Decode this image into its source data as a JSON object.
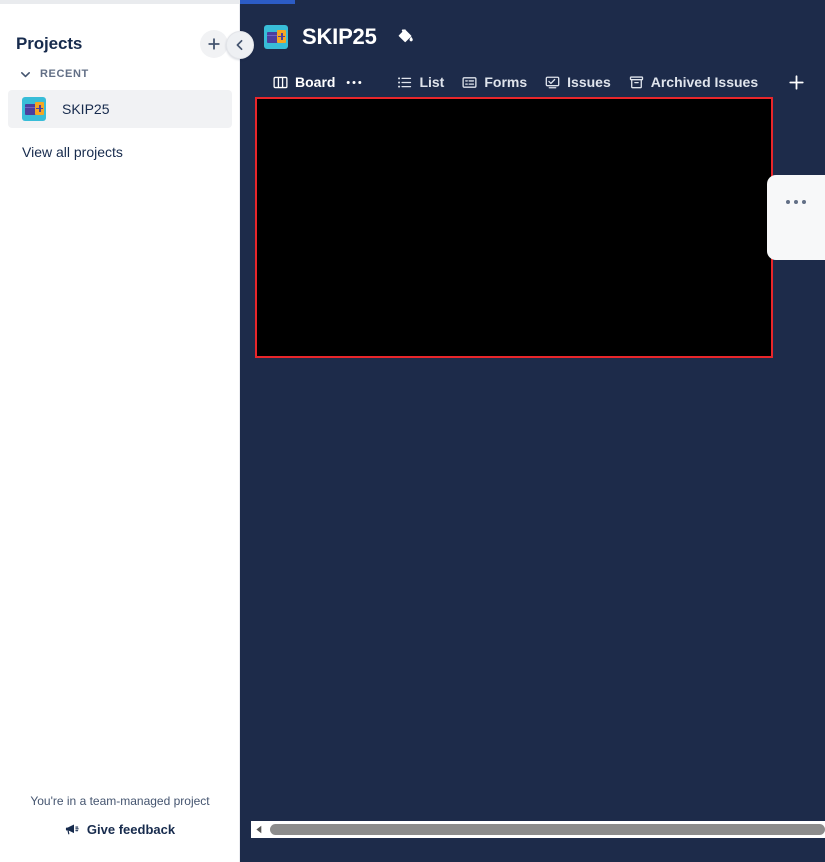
{
  "window": {
    "loading_progress": "partial"
  },
  "sidebar": {
    "title": "Projects",
    "add_button_icon": "plus-icon",
    "collapse_button_icon": "chevron-left-icon",
    "section": {
      "label": "RECENT",
      "chevron_icon": "chevron-down-icon"
    },
    "projects": [
      {
        "name": "SKIP25",
        "icon": "project-avatar-icon",
        "selected": true
      }
    ],
    "view_all_label": "View all projects",
    "footer": {
      "note": "You're in a team-managed project",
      "feedback_label": "Give feedback",
      "feedback_icon": "megaphone-icon"
    }
  },
  "main": {
    "project_title": "SKIP25",
    "paint_icon": "paint-bucket-icon",
    "tabs": [
      {
        "label": "Board",
        "icon": "board-columns-icon",
        "active": true
      },
      {
        "label": "List",
        "icon": "list-icon",
        "active": false
      },
      {
        "label": "Forms",
        "icon": "forms-icon",
        "active": false
      },
      {
        "label": "Issues",
        "icon": "issues-icon",
        "active": false
      },
      {
        "label": "Archived Issues",
        "icon": "archive-box-icon",
        "active": false
      }
    ],
    "tab_overflow_icon": "ellipsis-icon",
    "add_tab_icon": "plus-icon",
    "side_panel": {
      "menu_icon": "ellipsis-icon"
    },
    "scrollbar": {
      "left_arrow_icon": "triangle-left-icon"
    }
  },
  "colors": {
    "main_background": "#1d2b4a",
    "accent_blue": "#2c5cc5",
    "highlight_red": "#e8262b",
    "sidebar_background": "#ffffff",
    "selected_item_background": "#f1f2f4",
    "text_dark": "#172b4d"
  }
}
